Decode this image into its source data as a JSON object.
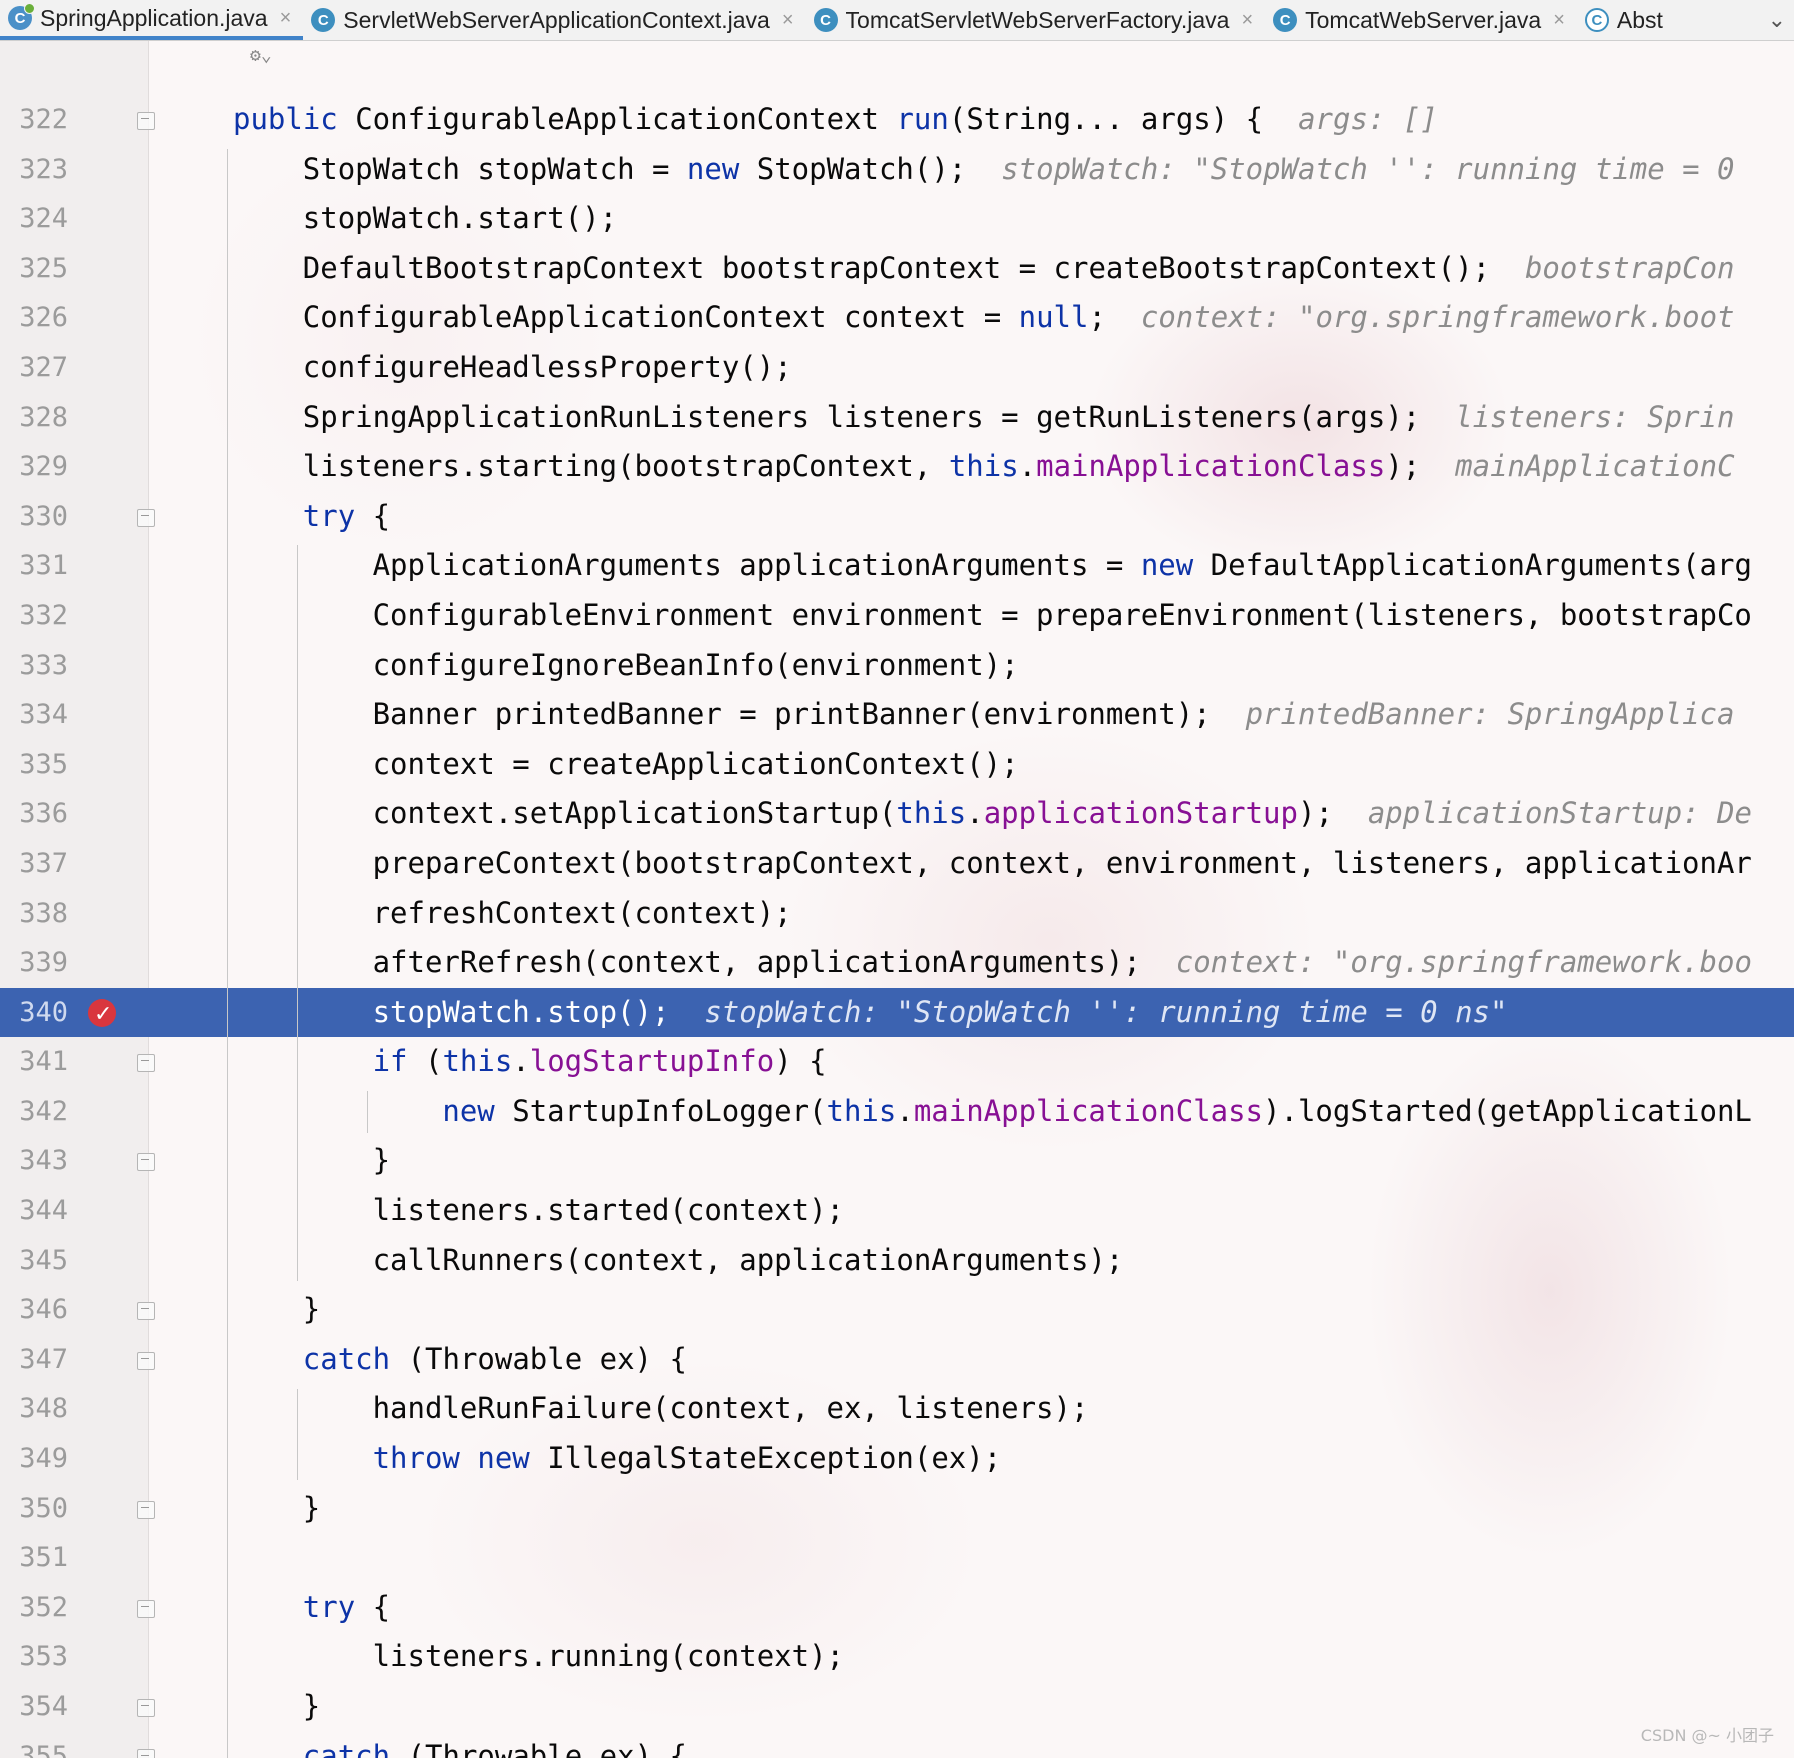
{
  "tabs": [
    {
      "label": "SpringApplication.java",
      "icon": "spring-class-icon",
      "active": true
    },
    {
      "label": "ServletWebServerApplicationContext.java",
      "icon": "class-icon",
      "active": false
    },
    {
      "label": "TomcatServletWebServerFactory.java",
      "icon": "class-icon",
      "active": false
    },
    {
      "label": "TomcatWebServer.java",
      "icon": "class-icon",
      "active": false
    },
    {
      "label": "Abst",
      "icon": "abstract-class-icon",
      "active": false
    }
  ],
  "editor": {
    "current_line": 340,
    "breakpoint_line": 340,
    "lines": [
      {
        "n": "322",
        "indent": 0,
        "fold": "open"
      },
      {
        "n": "323",
        "indent": 1
      },
      {
        "n": "324",
        "indent": 1
      },
      {
        "n": "325",
        "indent": 1
      },
      {
        "n": "326",
        "indent": 1
      },
      {
        "n": "327",
        "indent": 1
      },
      {
        "n": "328",
        "indent": 1
      },
      {
        "n": "329",
        "indent": 1
      },
      {
        "n": "330",
        "indent": 1,
        "fold": "open"
      },
      {
        "n": "331",
        "indent": 2
      },
      {
        "n": "332",
        "indent": 2
      },
      {
        "n": "333",
        "indent": 2
      },
      {
        "n": "334",
        "indent": 2
      },
      {
        "n": "335",
        "indent": 2
      },
      {
        "n": "336",
        "indent": 2
      },
      {
        "n": "337",
        "indent": 2
      },
      {
        "n": "338",
        "indent": 2
      },
      {
        "n": "339",
        "indent": 2
      },
      {
        "n": "340",
        "indent": 2
      },
      {
        "n": "341",
        "indent": 2,
        "fold": "open"
      },
      {
        "n": "342",
        "indent": 3
      },
      {
        "n": "343",
        "indent": 2,
        "fold": "close"
      },
      {
        "n": "344",
        "indent": 2
      },
      {
        "n": "345",
        "indent": 2
      },
      {
        "n": "346",
        "indent": 1,
        "fold": "close"
      },
      {
        "n": "347",
        "indent": 1,
        "fold": "open"
      },
      {
        "n": "348",
        "indent": 2
      },
      {
        "n": "349",
        "indent": 2
      },
      {
        "n": "350",
        "indent": 1,
        "fold": "close"
      },
      {
        "n": "351",
        "indent": 0
      },
      {
        "n": "352",
        "indent": 1,
        "fold": "open"
      },
      {
        "n": "353",
        "indent": 2
      },
      {
        "n": "354",
        "indent": 1,
        "fold": "close"
      },
      {
        "n": "355",
        "indent": 1,
        "fold": "open"
      }
    ],
    "code": {
      "l322": [
        [
          "kw",
          "public"
        ],
        [
          "t",
          " ConfigurableApplicationContext "
        ],
        [
          "kw",
          "run"
        ],
        [
          "t",
          "(String... args) {  "
        ],
        [
          "hint",
          "args: []"
        ]
      ],
      "l323": [
        [
          "t",
          "StopWatch stopWatch = "
        ],
        [
          "kw",
          "new"
        ],
        [
          "t",
          " StopWatch();  "
        ],
        [
          "hint",
          "stopWatch: \"StopWatch '': running time = 0"
        ]
      ],
      "l324": [
        [
          "t",
          "stopWatch.start();"
        ]
      ],
      "l325": [
        [
          "t",
          "DefaultBootstrapContext bootstrapContext = createBootstrapContext();  "
        ],
        [
          "hint",
          "bootstrapCon"
        ]
      ],
      "l326": [
        [
          "t",
          "ConfigurableApplicationContext context = "
        ],
        [
          "kw",
          "null"
        ],
        [
          "t",
          ";  "
        ],
        [
          "hint",
          "context: \"org.springframework.boot"
        ]
      ],
      "l327": [
        [
          "t",
          "configureHeadlessProperty();"
        ]
      ],
      "l328": [
        [
          "t",
          "SpringApplicationRunListeners listeners = getRunListeners(args);  "
        ],
        [
          "hint",
          "listeners: Sprin"
        ]
      ],
      "l329": [
        [
          "t",
          "listeners.starting(bootstrapContext, "
        ],
        [
          "kw",
          "this"
        ],
        [
          "t",
          "."
        ],
        [
          "fld",
          "mainApplicationClass"
        ],
        [
          "t",
          ");  "
        ],
        [
          "hint",
          "mainApplicationC"
        ]
      ],
      "l330": [
        [
          "kw",
          "try"
        ],
        [
          "t",
          " {"
        ]
      ],
      "l331": [
        [
          "t",
          "ApplicationArguments applicationArguments = "
        ],
        [
          "kw",
          "new"
        ],
        [
          "t",
          " DefaultApplicationArguments(arg"
        ]
      ],
      "l332": [
        [
          "t",
          "ConfigurableEnvironment environment = prepareEnvironment(listeners, bootstrapCo"
        ]
      ],
      "l333": [
        [
          "t",
          "configureIgnoreBeanInfo(environment);"
        ]
      ],
      "l334": [
        [
          "t",
          "Banner printedBanner = printBanner(environment);  "
        ],
        [
          "hint",
          "printedBanner: SpringApplica"
        ]
      ],
      "l335": [
        [
          "t",
          "context = createApplicationContext();"
        ]
      ],
      "l336": [
        [
          "t",
          "context.setApplicationStartup("
        ],
        [
          "kw",
          "this"
        ],
        [
          "t",
          "."
        ],
        [
          "fld",
          "applicationStartup"
        ],
        [
          "t",
          ");  "
        ],
        [
          "hint",
          "applicationStartup: De"
        ]
      ],
      "l337": [
        [
          "t",
          "prepareContext(bootstrapContext, context, environment, listeners, applicationAr"
        ]
      ],
      "l338": [
        [
          "t",
          "refreshContext(context);"
        ]
      ],
      "l339": [
        [
          "t",
          "afterRefresh(context, applicationArguments);  "
        ],
        [
          "hint",
          "context: \"org.springframework.boo"
        ]
      ],
      "l340": [
        [
          "t",
          "stopWatch.stop();  "
        ],
        [
          "hint",
          "stopWatch: \"StopWatch '': running time = 0 ns\""
        ]
      ],
      "l341": [
        [
          "kw",
          "if"
        ],
        [
          "t",
          " ("
        ],
        [
          "kw",
          "this"
        ],
        [
          "t",
          "."
        ],
        [
          "fld",
          "logStartupInfo"
        ],
        [
          "t",
          ") {"
        ]
      ],
      "l342": [
        [
          "kw",
          "new"
        ],
        [
          "t",
          " StartupInfoLogger("
        ],
        [
          "kw",
          "this"
        ],
        [
          "t",
          "."
        ],
        [
          "fld",
          "mainApplicationClass"
        ],
        [
          "t",
          ").logStarted(getApplicationL"
        ]
      ],
      "l343": [
        [
          "t",
          "}"
        ]
      ],
      "l344": [
        [
          "t",
          "listeners.started(context);"
        ]
      ],
      "l345": [
        [
          "t",
          "callRunners(context, applicationArguments);"
        ]
      ],
      "l346": [
        [
          "t",
          "}"
        ]
      ],
      "l347": [
        [
          "kw",
          "catch"
        ],
        [
          "t",
          " (Throwable ex) {"
        ]
      ],
      "l348": [
        [
          "t",
          "handleRunFailure(context, ex, listeners);"
        ]
      ],
      "l349": [
        [
          "kw",
          "throw"
        ],
        [
          "t",
          " "
        ],
        [
          "kw",
          "new"
        ],
        [
          "t",
          " IllegalStateException(ex);"
        ]
      ],
      "l350": [
        [
          "t",
          "}"
        ]
      ],
      "l351": [
        [
          "t",
          ""
        ]
      ],
      "l352": [
        [
          "kw",
          "try"
        ],
        [
          "t",
          " {"
        ]
      ],
      "l353": [
        [
          "t",
          "listeners.running(context);"
        ]
      ],
      "l354": [
        [
          "t",
          "}"
        ]
      ],
      "l355": [
        [
          "kw",
          "catch"
        ],
        [
          "t",
          " (Throwable ex) {"
        ]
      ]
    }
  },
  "watermark": "CSDN @~ 小团子"
}
